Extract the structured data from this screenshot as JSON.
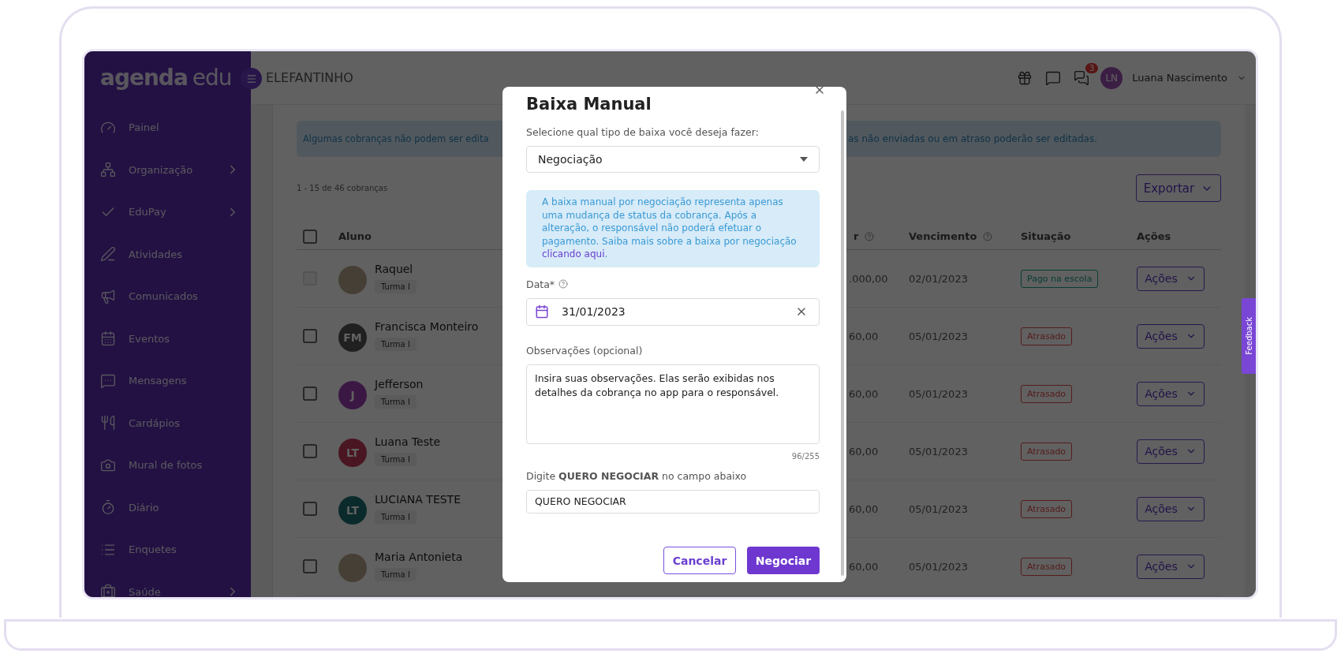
{
  "brand": {
    "logo_main": "agenda",
    "logo_sub": "edu"
  },
  "header": {
    "school": "ELEFANTINHO",
    "notifications": "3",
    "user": {
      "initials": "LN",
      "name": "Luana Nascimento"
    }
  },
  "sidebar": {
    "items": [
      {
        "label": "Painel",
        "expandable": false
      },
      {
        "label": "Organização",
        "expandable": true
      },
      {
        "label": "EduPay",
        "expandable": true
      },
      {
        "label": "Atividades",
        "expandable": false
      },
      {
        "label": "Comunicados",
        "expandable": false
      },
      {
        "label": "Eventos",
        "expandable": false
      },
      {
        "label": "Mensagens",
        "expandable": false
      },
      {
        "label": "Cardápios",
        "expandable": false
      },
      {
        "label": "Mural de fotos",
        "expandable": false
      },
      {
        "label": "Diário",
        "expandable": false
      },
      {
        "label": "Enquetes",
        "expandable": false
      },
      {
        "label": "Saúde",
        "expandable": true
      }
    ]
  },
  "page": {
    "alert_left": "Algumas cobranças não podem ser edita",
    "alert_right": "as não enviadas ou em atraso poderão ser editadas.",
    "count": "1 - 15 de 46 cobranças",
    "export": "Exportar"
  },
  "table": {
    "select_all_checked": false,
    "columns": [
      {
        "label": "Aluno",
        "help": false
      },
      {
        "label": "r",
        "help": true
      },
      {
        "label": "Vencimento",
        "help": true
      },
      {
        "label": "Situação",
        "help": false
      },
      {
        "label": "Ações",
        "help": false
      }
    ],
    "rows": [
      {
        "name": "Raquel",
        "class": "Turma I",
        "avatar": {
          "kind": "photo"
        },
        "checked": false,
        "disabled": true,
        "value": ".000,00",
        "due": "02/01/2023",
        "status": {
          "kind": "paid",
          "label": "Pago na escola"
        },
        "action": "Ações"
      },
      {
        "name": "Francisca Monteiro",
        "class": "Turma I",
        "avatar": {
          "kind": "initials",
          "initials": "FM"
        },
        "checked": false,
        "disabled": false,
        "value": "60,00",
        "due": "05/01/2023",
        "status": {
          "kind": "late",
          "label": "Atrasado"
        },
        "action": "Ações"
      },
      {
        "name": "Jefferson",
        "class": "Turma I",
        "avatar": {
          "kind": "initials",
          "initials": "J"
        },
        "checked": false,
        "disabled": false,
        "value": "60,00",
        "due": "05/01/2023",
        "status": {
          "kind": "late",
          "label": "Atrasado"
        },
        "action": "Ações"
      },
      {
        "name": "Luana Teste",
        "class": "Turma I",
        "avatar": {
          "kind": "initials",
          "initials": "LT"
        },
        "checked": false,
        "disabled": false,
        "value": "60,00",
        "due": "05/01/2023",
        "status": {
          "kind": "late",
          "label": "Atrasado"
        },
        "action": "Ações"
      },
      {
        "name": "LUCIANA TESTE",
        "class": "Turma I",
        "avatar": {
          "kind": "initials",
          "initials": "LT"
        },
        "checked": false,
        "disabled": false,
        "value": "60,00",
        "due": "05/01/2023",
        "status": {
          "kind": "late",
          "label": "Atrasado"
        },
        "action": "Ações"
      },
      {
        "name": "Maria Antonieta",
        "class": "Turma I",
        "avatar": {
          "kind": "photo"
        },
        "checked": false,
        "disabled": false,
        "value": "60,00",
        "due": "05/01/2023",
        "status": {
          "kind": "late",
          "label": "Atrasado"
        },
        "action": "Ações"
      }
    ]
  },
  "feedback": {
    "label": "Feedback"
  },
  "modal": {
    "title": "Baixa Manual",
    "type_label": "Selecione qual tipo de baixa você deseja fazer:",
    "type_value": "Negociação",
    "info": "A baixa manual por negociação representa apenas uma mudança de status da cobrança. Após a alteração, o responsável não poderá efetuar o pagamento. Saiba mais sobre a baixa por negociação",
    "info_link": "clicando aqui",
    "info_end": ".",
    "date_label": "Data*",
    "date_value": "31/01/2023",
    "notes_label": "Observações (opcional)",
    "notes_value": "Insira suas observações. Elas serão exibidas nos detalhes da cobrança no app para o responsável.",
    "notes_count": "96/255",
    "confirm_label": "Digite **QUERO NEGOCIAR** no campo abaixo",
    "confirm_value": "QUERO NEGOCIAR",
    "cancel": "Cancelar",
    "submit": "Negociar"
  }
}
